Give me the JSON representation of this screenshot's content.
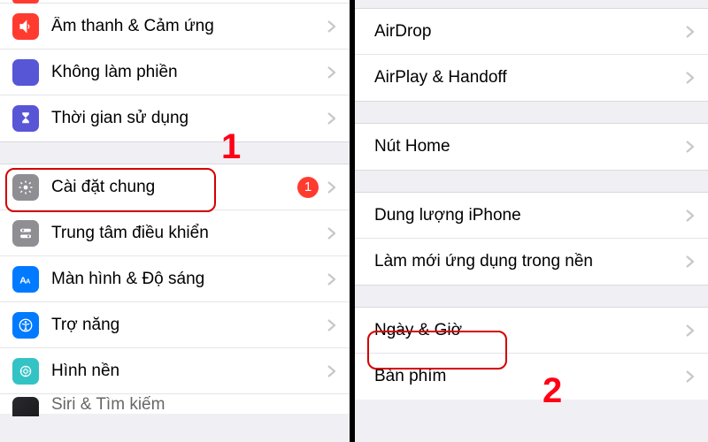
{
  "left": {
    "items": [
      {
        "label": "Âm thanh & Cảm ứng"
      },
      {
        "label": "Không làm phiền"
      },
      {
        "label": "Thời gian sử dụng"
      },
      {
        "label": "Cài đặt chung",
        "badge": "1"
      },
      {
        "label": "Trung tâm điều khiển"
      },
      {
        "label": "Màn hình & Độ sáng"
      },
      {
        "label": "Trợ năng"
      },
      {
        "label": "Hình nền"
      },
      {
        "label": "Siri & Tìm kiếm"
      }
    ]
  },
  "right": {
    "items": [
      {
        "label": "AirDrop"
      },
      {
        "label": "AirPlay & Handoff"
      },
      {
        "label": "Nút Home"
      },
      {
        "label": "Dung lượng iPhone"
      },
      {
        "label": "Làm mới ứng dụng trong nền"
      },
      {
        "label": "Ngày & Giờ"
      },
      {
        "label": "Bàn phím"
      }
    ]
  },
  "steps": {
    "one": "1",
    "two": "2"
  }
}
